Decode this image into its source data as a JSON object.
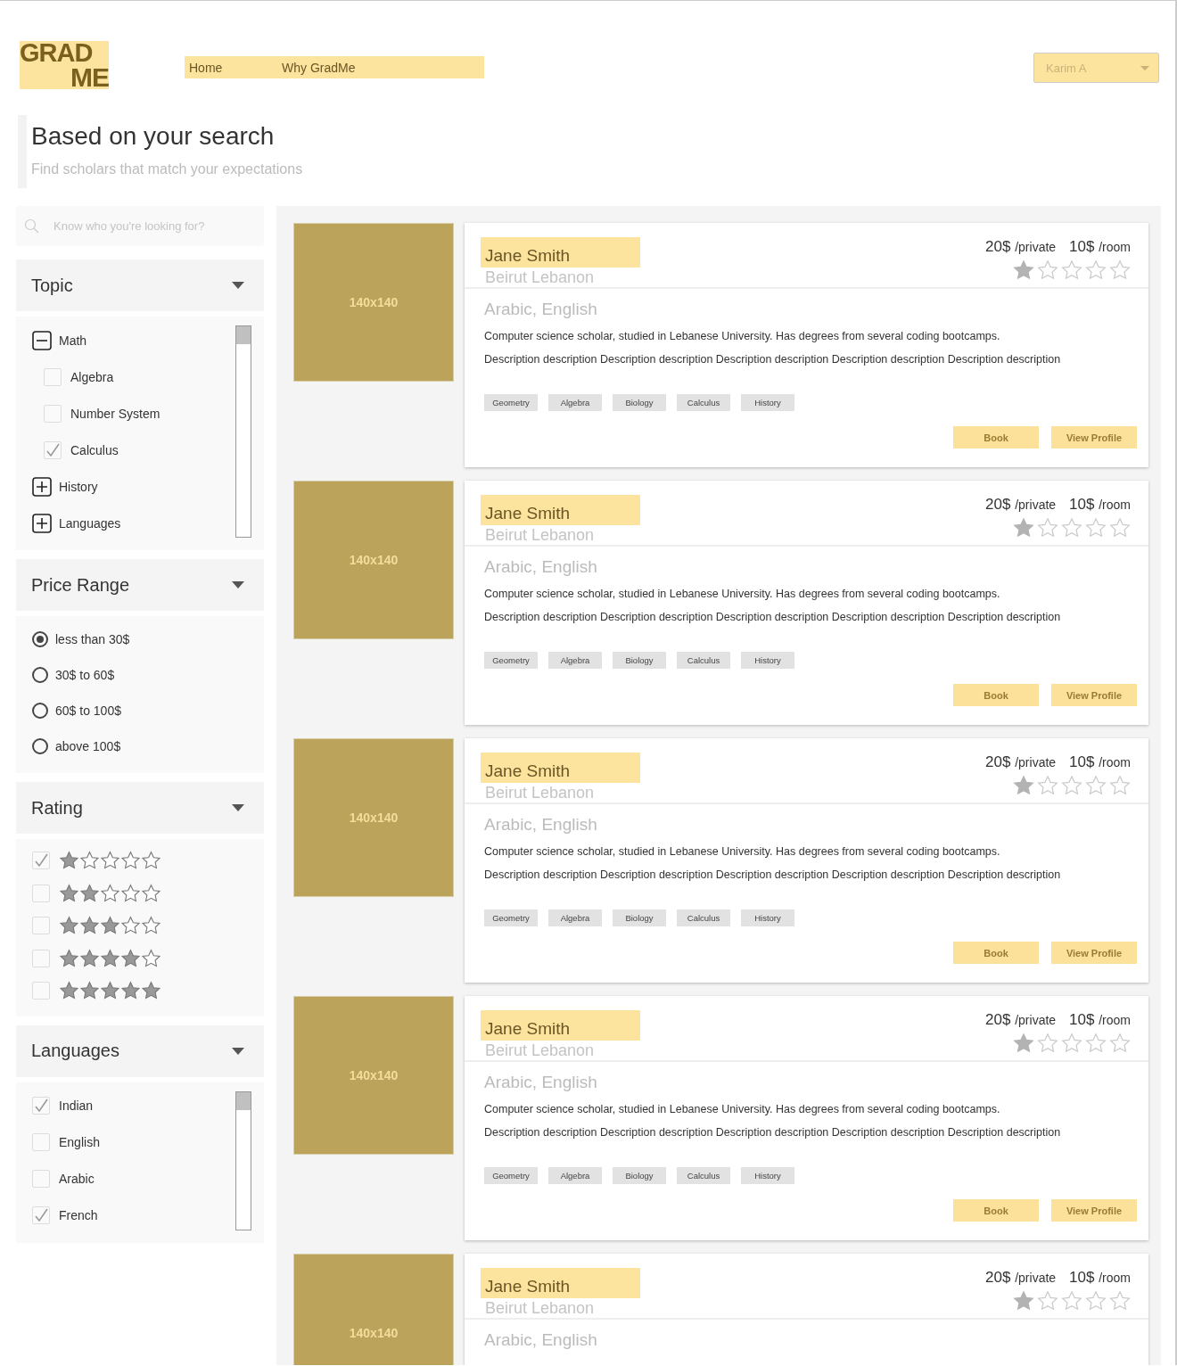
{
  "logo": {
    "lines": [
      "GRAD",
      "ME"
    ]
  },
  "nav": [
    {
      "label": "Home"
    },
    {
      "label": "Why GradMe"
    }
  ],
  "user_menu": {
    "label": "Karim A"
  },
  "intro": {
    "title": "Based on your search",
    "subtitle": "Find scholars that match your expectations"
  },
  "search": {
    "placeholder": "Know who you're looking for?"
  },
  "filters": [
    {
      "kind": "tree",
      "title": "Topic",
      "items": [
        {
          "label": "Math",
          "expanded": true,
          "children": [
            {
              "label": "Algebra",
              "checked": false
            },
            {
              "label": "Number System",
              "checked": false
            },
            {
              "label": "Calculus",
              "checked": true
            }
          ]
        },
        {
          "label": "History",
          "expanded": false
        },
        {
          "label": "Languages",
          "expanded": false
        }
      ]
    },
    {
      "kind": "radio",
      "title": "Price Range",
      "items": [
        {
          "label": "less than 30$",
          "selected": true
        },
        {
          "label": "30$ to 60$",
          "selected": false
        },
        {
          "label": "60$ to 100$",
          "selected": false
        },
        {
          "label": "above 100$",
          "selected": false
        }
      ]
    },
    {
      "kind": "stars",
      "title": "Rating",
      "items": [
        {
          "stars": 1,
          "checked": true
        },
        {
          "stars": 2,
          "checked": false
        },
        {
          "stars": 3,
          "checked": false
        },
        {
          "stars": 4,
          "checked": false
        },
        {
          "stars": 5,
          "checked": false
        }
      ]
    },
    {
      "kind": "checklist",
      "title": "Languages",
      "items": [
        {
          "label": "Indian",
          "checked": true
        },
        {
          "label": "English",
          "checked": false
        },
        {
          "label": "Arabic",
          "checked": false
        },
        {
          "label": "French",
          "checked": true
        }
      ]
    }
  ],
  "cards": [
    {
      "image_label": "140x140",
      "name": "Jane Smith",
      "location": "Beirut Lebanon",
      "prices": [
        {
          "amount": "20$",
          "unit": "/private"
        },
        {
          "amount": "10$",
          "unit": "/room"
        }
      ],
      "stars": 1,
      "languages": "Arabic, English",
      "description": [
        "Computer science scholar, studied in Lebanese University. Has degrees from several coding bootcamps.",
        "Description description Description description Description description Description description Description description"
      ],
      "tags": [
        "Geometry",
        "Algebra",
        "Biology",
        "Calculus",
        "History"
      ],
      "actions": [
        "Book",
        "View Profile"
      ]
    },
    {
      "image_label": "140x140",
      "name": "Jane Smith",
      "location": "Beirut Lebanon",
      "prices": [
        {
          "amount": "20$",
          "unit": "/private"
        },
        {
          "amount": "10$",
          "unit": "/room"
        }
      ],
      "stars": 1,
      "languages": "Arabic, English",
      "description": [
        "Computer science scholar, studied in Lebanese University. Has degrees from several coding bootcamps.",
        "Description description Description description Description description Description description Description description"
      ],
      "tags": [
        "Geometry",
        "Algebra",
        "Biology",
        "Calculus",
        "History"
      ],
      "actions": [
        "Book",
        "View Profile"
      ]
    },
    {
      "image_label": "140x140",
      "name": "Jane Smith",
      "location": "Beirut Lebanon",
      "prices": [
        {
          "amount": "20$",
          "unit": "/private"
        },
        {
          "amount": "10$",
          "unit": "/room"
        }
      ],
      "stars": 1,
      "languages": "Arabic, English",
      "description": [
        "Computer science scholar, studied in Lebanese University. Has degrees from several coding bootcamps.",
        "Description description Description description Description description Description description Description description"
      ],
      "tags": [
        "Geometry",
        "Algebra",
        "Biology",
        "Calculus",
        "History"
      ],
      "actions": [
        "Book",
        "View Profile"
      ]
    },
    {
      "image_label": "140x140",
      "name": "Jane Smith",
      "location": "Beirut Lebanon",
      "prices": [
        {
          "amount": "20$",
          "unit": "/private"
        },
        {
          "amount": "10$",
          "unit": "/room"
        }
      ],
      "stars": 1,
      "languages": "Arabic, English",
      "description": [
        "Computer science scholar, studied in Lebanese University. Has degrees from several coding bootcamps.",
        "Description description Description description Description description Description description Description description"
      ],
      "tags": [
        "Geometry",
        "Algebra",
        "Biology",
        "Calculus",
        "History"
      ],
      "actions": [
        "Book",
        "View Profile"
      ]
    },
    {
      "image_label": "140x140",
      "name": "Jane Smith",
      "location": "Beirut Lebanon",
      "prices": [
        {
          "amount": "20$",
          "unit": "/private"
        },
        {
          "amount": "10$",
          "unit": "/room"
        }
      ],
      "stars": 1,
      "languages": "Arabic, English"
    }
  ]
}
